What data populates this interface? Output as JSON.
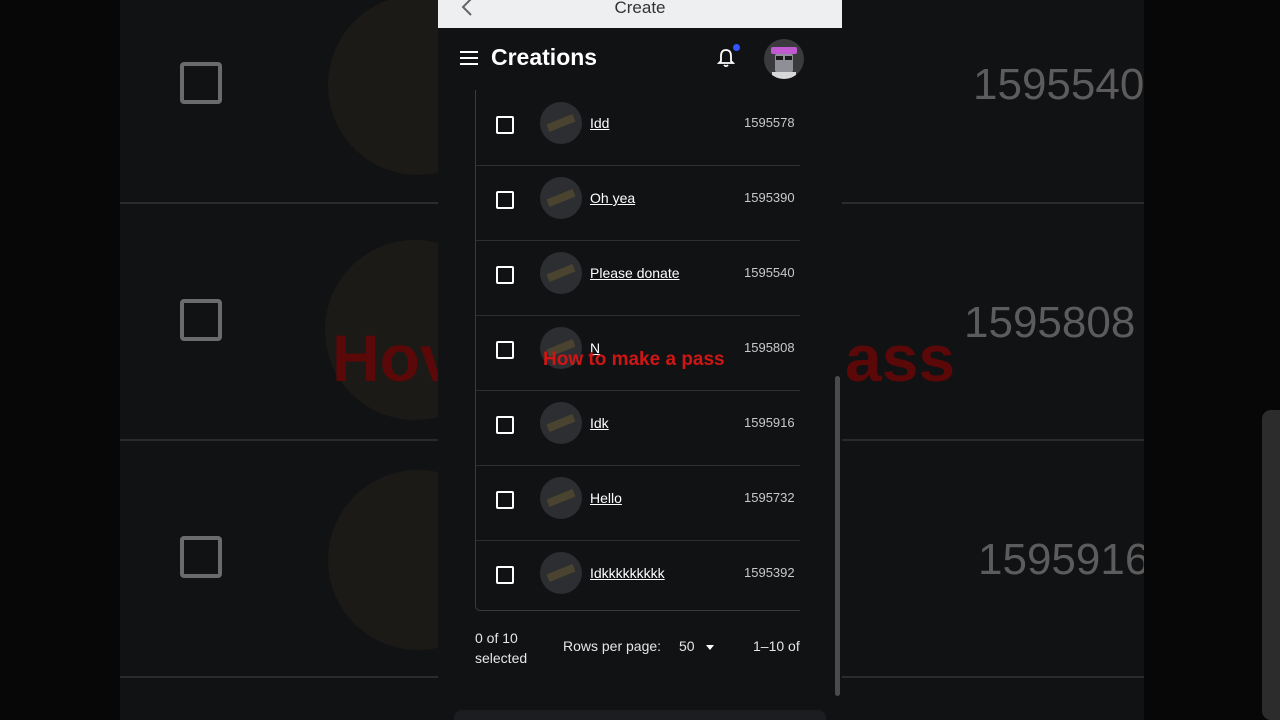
{
  "topbar": {
    "title": "Create"
  },
  "header": {
    "title": "Creations"
  },
  "rows": [
    {
      "name": "Idd",
      "id": "1595578"
    },
    {
      "name": "Oh yea",
      "id": "1595390"
    },
    {
      "name": "Please donate",
      "id": "1595540"
    },
    {
      "name": "N",
      "id": "1595808"
    },
    {
      "name": "Idk",
      "id": "1595916"
    },
    {
      "name": "Hello",
      "id": "1595732"
    },
    {
      "name": "Idkkkkkkkkk",
      "id": "1595392"
    }
  ],
  "overlay": {
    "text": "How to make a pass"
  },
  "footer": {
    "selected": "0 of 10 selected",
    "rows_per_page_label": "Rows per page:",
    "rows_per_page_value": "50",
    "range": "1–10 of"
  },
  "background": {
    "numbers": [
      "1595540",
      "1595808",
      "1595916"
    ],
    "red_left": "Hov",
    "red_right": "ass"
  },
  "colors": {
    "notification_dot": "#3355ff",
    "overlay_text": "#d01515"
  }
}
